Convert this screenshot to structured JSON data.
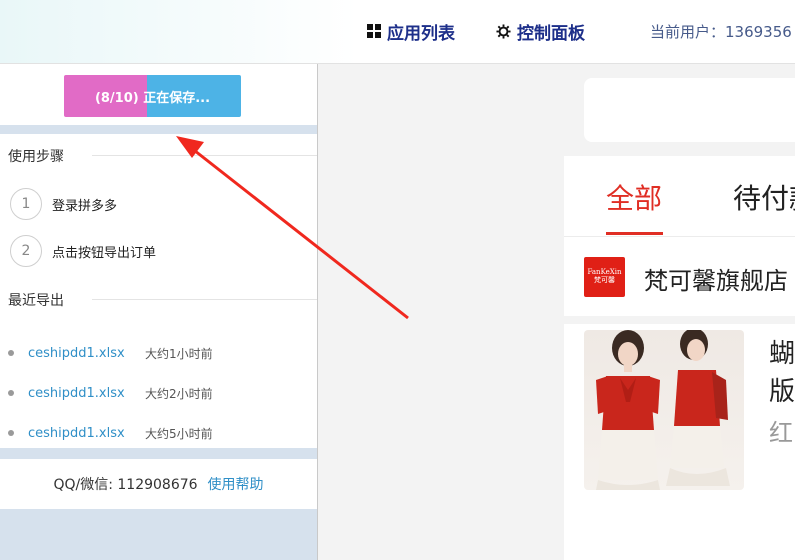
{
  "header": {
    "nav_apps": "应用列表",
    "nav_control": "控制面板",
    "current_user": "当前用户：1369356"
  },
  "panel": {
    "progress_label": "(8/10) 正在保存...",
    "steps_title": "使用步骤",
    "steps": [
      {
        "num": "1",
        "label": "登录拼多多"
      },
      {
        "num": "2",
        "label": "点击按钮导出订单"
      }
    ],
    "recent_title": "最近导出",
    "recent": [
      {
        "file": "ceshipdd1.xlsx",
        "time": "大约1小时前"
      },
      {
        "file": "ceshipdd1.xlsx",
        "time": "大约2小时前"
      },
      {
        "file": "ceshipdd1.xlsx",
        "time": "大约5小时前"
      }
    ],
    "contact": "QQ/微信: 112908676",
    "help": "使用帮助"
  },
  "orders": {
    "tabs": [
      "全部",
      "待付款"
    ],
    "store_logo_en": "FanKeXin",
    "store_logo_cn": "梵可馨",
    "store_name": "梵可馨旗舰店",
    "product_title_line1": "蝴",
    "product_title_line2": "版",
    "product_spec": "红"
  },
  "colors": {
    "accent_red": "#e02e24",
    "progress_pink": "#e16bc6",
    "progress_blue": "#4db3e6",
    "link_blue": "#2f8fc7",
    "nav_blue": "#1d2f8a"
  }
}
